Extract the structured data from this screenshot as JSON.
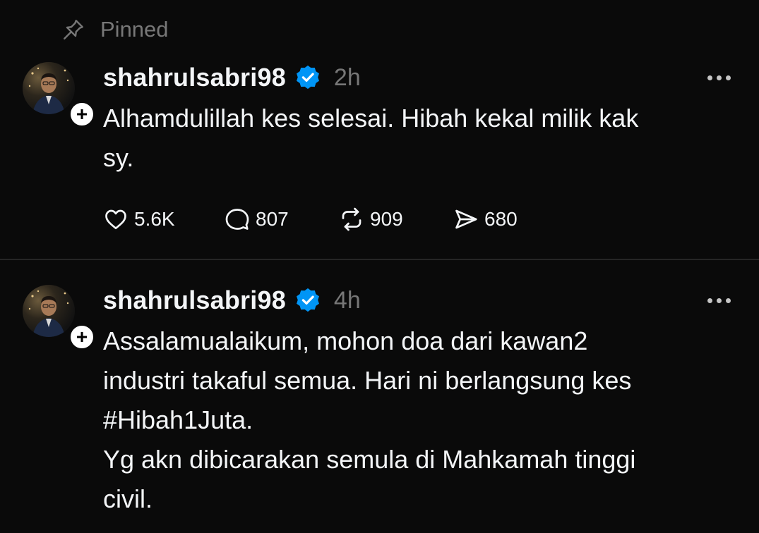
{
  "pinned_label": "Pinned",
  "posts": [
    {
      "username": "shahrulsabri98",
      "time": "2h",
      "lines": [
        "Alhamdulillah kes selesai. Hibah kekal milik kak",
        "sy."
      ],
      "likes": "5.6K",
      "replies": "807",
      "reposts": "909",
      "shares": "680"
    },
    {
      "username": "shahrulsabri98",
      "time": "4h",
      "lines": [
        "Assalamualaikum, mohon doa dari kawan2",
        "industri takaful semua. Hari ni berlangsung kes",
        "#Hibah1Juta.",
        "Yg akn dibicarakan semula di Mahkamah tinggi",
        "civil."
      ]
    }
  ],
  "icons": {
    "pin": "pin-icon",
    "verified": "verified-badge-icon",
    "follow": "plus-icon",
    "more": "more-horizontal-icon",
    "like": "heart-icon",
    "reply": "comment-bubble-icon",
    "repost": "repost-arrows-icon",
    "share": "paper-plane-icon"
  },
  "colors": {
    "background": "#0a0a0a",
    "text": "#f3f5f7",
    "muted": "#777777",
    "verified": "#0095f6",
    "divider": "#262626"
  }
}
